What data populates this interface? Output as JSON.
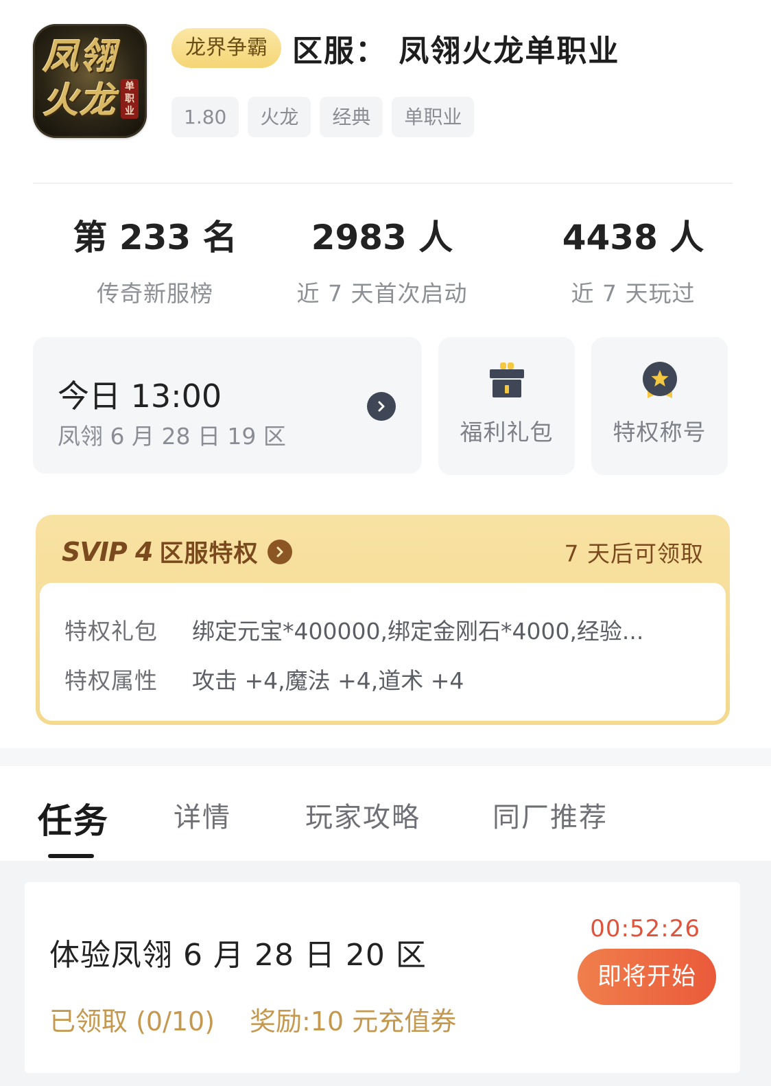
{
  "header": {
    "app_icon_text": "凤翎火龙",
    "app_icon_seal": "单职业",
    "badge": "龙界争霸",
    "title": "区服：  凤翎火龙单职业",
    "tags": [
      "1.80",
      "火龙",
      "经典",
      "单职业"
    ]
  },
  "stats": [
    {
      "value": "第 233 名",
      "label": "传奇新服榜"
    },
    {
      "value": "2983 人",
      "label": "近 7 天首次启动"
    },
    {
      "value": "4438 人",
      "label": "近 7 天玩过"
    }
  ],
  "open_server": {
    "time": "今日  13:00",
    "server": "凤翎 6 月 28 日 19 区"
  },
  "shortcuts": [
    {
      "label": "福利礼包",
      "icon": "gift-icon"
    },
    {
      "label": "特权称号",
      "icon": "medal-icon"
    }
  ],
  "svip": {
    "logo": "SVIP 4",
    "title": "区服特权",
    "claim_text": "7 天后可领取",
    "rows": [
      {
        "key": "特权礼包",
        "value": "绑定元宝*400000,绑定金刚石*4000,经验..."
      },
      {
        "key": "特权属性",
        "value": "攻击 +4,魔法 +4,道术 +4"
      }
    ]
  },
  "tabs": [
    "任务",
    "详情",
    "玩家攻略",
    "同厂推荐"
  ],
  "active_tab": 0,
  "task": {
    "name": "体验凤翎 6 月 28 日 20 区",
    "status": "已领取 (0/10)",
    "reward": "奖励:10 元充值券",
    "countdown": "00:52:26",
    "button": "即将开始"
  },
  "colors": {
    "accent": "#ea5a3a",
    "gold_text": "#c4994f",
    "svip_bg": "#f6dc97",
    "svip_text": "#7a4a1e"
  }
}
